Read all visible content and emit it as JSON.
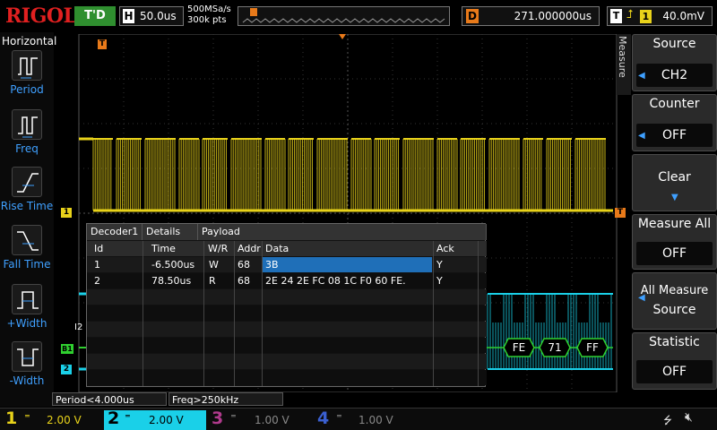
{
  "topbar": {
    "brand": "RIGOL",
    "trigger_status": "T'D",
    "timebase_icon": "H",
    "timebase": "50.0us",
    "sample_rate": "500MSa/s",
    "memory_depth": "300k pts",
    "delay_icon": "D",
    "delay": "271.000000us",
    "trig_icon": "T",
    "trig_edge": "rising-edge-icon",
    "trig_source": "1",
    "trig_level": "40.0mV"
  },
  "leftpanel": {
    "title": "Horizontal",
    "items": [
      {
        "label": "Period",
        "icon": "period-icon"
      },
      {
        "label": "Freq",
        "icon": "frequency-icon"
      },
      {
        "label": "Rise Time",
        "icon": "rise-time-icon"
      },
      {
        "label": "Fall Time",
        "icon": "fall-time-icon"
      },
      {
        "label": "+Width",
        "icon": "positive-width-icon"
      },
      {
        "label": "-Width",
        "icon": "negative-width-icon"
      }
    ]
  },
  "rightpanel": {
    "side_label": "Measure",
    "source": {
      "label": "Source",
      "value": "CH2"
    },
    "counter": {
      "label": "Counter",
      "value": "OFF"
    },
    "clear": {
      "label": "Clear"
    },
    "measure_all": {
      "label": "Measure All",
      "value": "OFF"
    },
    "all_measure_source": {
      "label1": "All Measure",
      "label2": "Source"
    },
    "statistic": {
      "label": "Statistic",
      "value": "OFF"
    }
  },
  "decoder": {
    "tabs": [
      "Decoder1",
      "Details",
      "Payload"
    ],
    "headers": {
      "id": "Id",
      "time": "Time",
      "wr": "W/R",
      "addr": "Addr",
      "data": "Data",
      "ack": "Ack"
    },
    "rows": [
      {
        "id": "1",
        "time": "-6.500us",
        "wr": "W",
        "addr": "68",
        "data": "3B",
        "ack": "Y"
      },
      {
        "id": "2",
        "time": "78.50us",
        "wr": "R",
        "addr": "68",
        "data": "2E 24 2E FC 08 1C F0 60 FE.",
        "ack": "Y"
      }
    ]
  },
  "bus": {
    "label": "B1",
    "partial_label": "I2",
    "bytes": [
      "FE",
      "71",
      "FF"
    ]
  },
  "markers": {
    "ch1": "1",
    "ch2": "2",
    "trigger": "T"
  },
  "footer": {
    "period": "Period<4.000us",
    "freq": "Freq>250kHz"
  },
  "channels": [
    {
      "num": "1",
      "scale": "2.00 V",
      "color": "#e8d21a",
      "active": true
    },
    {
      "num": "2",
      "scale": "2.00 V",
      "color": "#1ad0e8",
      "active": true
    },
    {
      "num": "3",
      "scale": "1.00 V",
      "color": "#b03a8c",
      "active": false
    },
    {
      "num": "4",
      "scale": "1.00 V",
      "color": "#3a5fd0",
      "active": false
    }
  ],
  "colors": {
    "ch1": "#e8d21a",
    "ch2": "#1ad0e8",
    "trigger": "#e87a1a",
    "bus": "#2fd02f",
    "accent": "#1f6fb8"
  }
}
